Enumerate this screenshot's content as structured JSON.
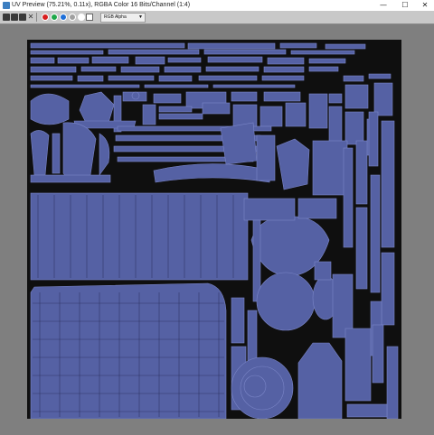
{
  "window": {
    "title": "UV Preview (75.21%, 0.11x), RGBA Color 16 Bits/Channel (1:4)",
    "app_icon": "uv-preview-app-icon",
    "minimize_glyph": "—",
    "maximize_glyph": "☐",
    "close_glyph": "✕"
  },
  "toolbar": {
    "icons": [
      "save-icon",
      "copy-icon",
      "print-icon",
      "clear-icon"
    ],
    "channel_colors": [
      "#d81e1e",
      "#1fa84a",
      "#1f6fd8",
      "#a0a0a0"
    ],
    "color_swatch": "#ffffff",
    "channel_select_value": "RGB Alpha"
  },
  "uv_view": {
    "background": "#0f0f0f",
    "island_fill": "#5561a4",
    "island_edge": "#7b86c8",
    "seam_color": "#2a2f5a"
  }
}
